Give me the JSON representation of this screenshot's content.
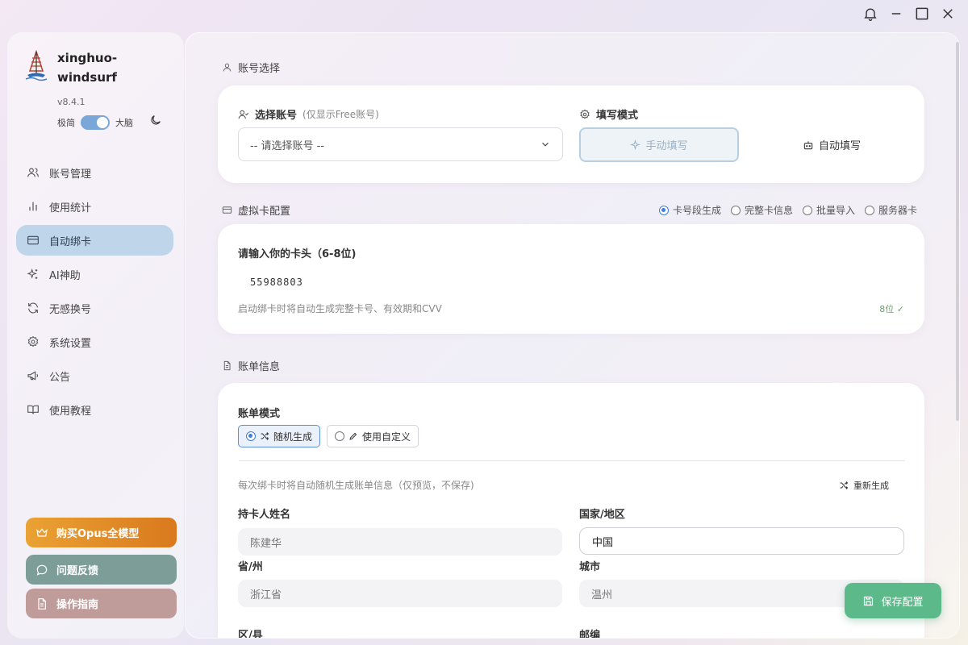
{
  "app": {
    "name": "xinghuo-windsurf",
    "version": "v8.4.1",
    "mode_left": "极简",
    "mode_right": "大脑"
  },
  "nav": [
    {
      "label": "账号管理",
      "icon": "users-icon",
      "active": false
    },
    {
      "label": "使用统计",
      "icon": "bar-chart-icon",
      "active": false
    },
    {
      "label": "自动绑卡",
      "icon": "credit-card-icon",
      "active": true
    },
    {
      "label": "AI神助",
      "icon": "sparkles-icon",
      "active": false
    },
    {
      "label": "无感换号",
      "icon": "refresh-icon",
      "active": false
    },
    {
      "label": "系统设置",
      "icon": "gear-icon",
      "active": false
    },
    {
      "label": "公告",
      "icon": "megaphone-icon",
      "active": false
    },
    {
      "label": "使用教程",
      "icon": "book-icon",
      "active": false
    }
  ],
  "side_buttons": {
    "opus": "购买Opus全模型",
    "feedback": "问题反馈",
    "guide": "操作指南"
  },
  "account": {
    "section_title": "账号选择",
    "select_label": "选择账号",
    "select_hint": "(仅显示Free账号)",
    "select_placeholder": "-- 请选择账号 --",
    "fill_mode_label": "填写模式",
    "manual_label": "手动填写",
    "auto_label": "自动填写"
  },
  "vcard": {
    "section_title": "虚拟卡配置",
    "options": [
      {
        "label": "卡号段生成",
        "selected": true
      },
      {
        "label": "完整卡信息",
        "selected": false
      },
      {
        "label": "批量导入",
        "selected": false
      },
      {
        "label": "服务器卡",
        "selected": false
      }
    ],
    "prompt": "请输入你的卡头（6-8位)",
    "value": "55988803",
    "note": "启动绑卡时将自动生成完整卡号、有效期和CVV",
    "status": "8位 ✓"
  },
  "billing": {
    "section_title": "账单信息",
    "mode_label": "账单模式",
    "mode_random": "随机生成",
    "mode_custom": "使用自定义",
    "note": "每次绑卡时将自动随机生成账单信息（仅预览，不保存)",
    "regenerate": "重新生成",
    "fields": {
      "name_label": "持卡人姓名",
      "name_value": "陈建华",
      "country_label": "国家/地区",
      "country_value": "中国",
      "province_label": "省/州",
      "province_value": "浙江省",
      "city_label": "城市",
      "city_value": "温州",
      "district_label": "区/县",
      "zip_label": "邮编"
    }
  },
  "save_label": "保存配置",
  "colors": {
    "accent": "#3f7de0",
    "active_nav": "#bfd6ea",
    "save_green": "#5bb98a",
    "opus_orange": "#e0882a"
  }
}
